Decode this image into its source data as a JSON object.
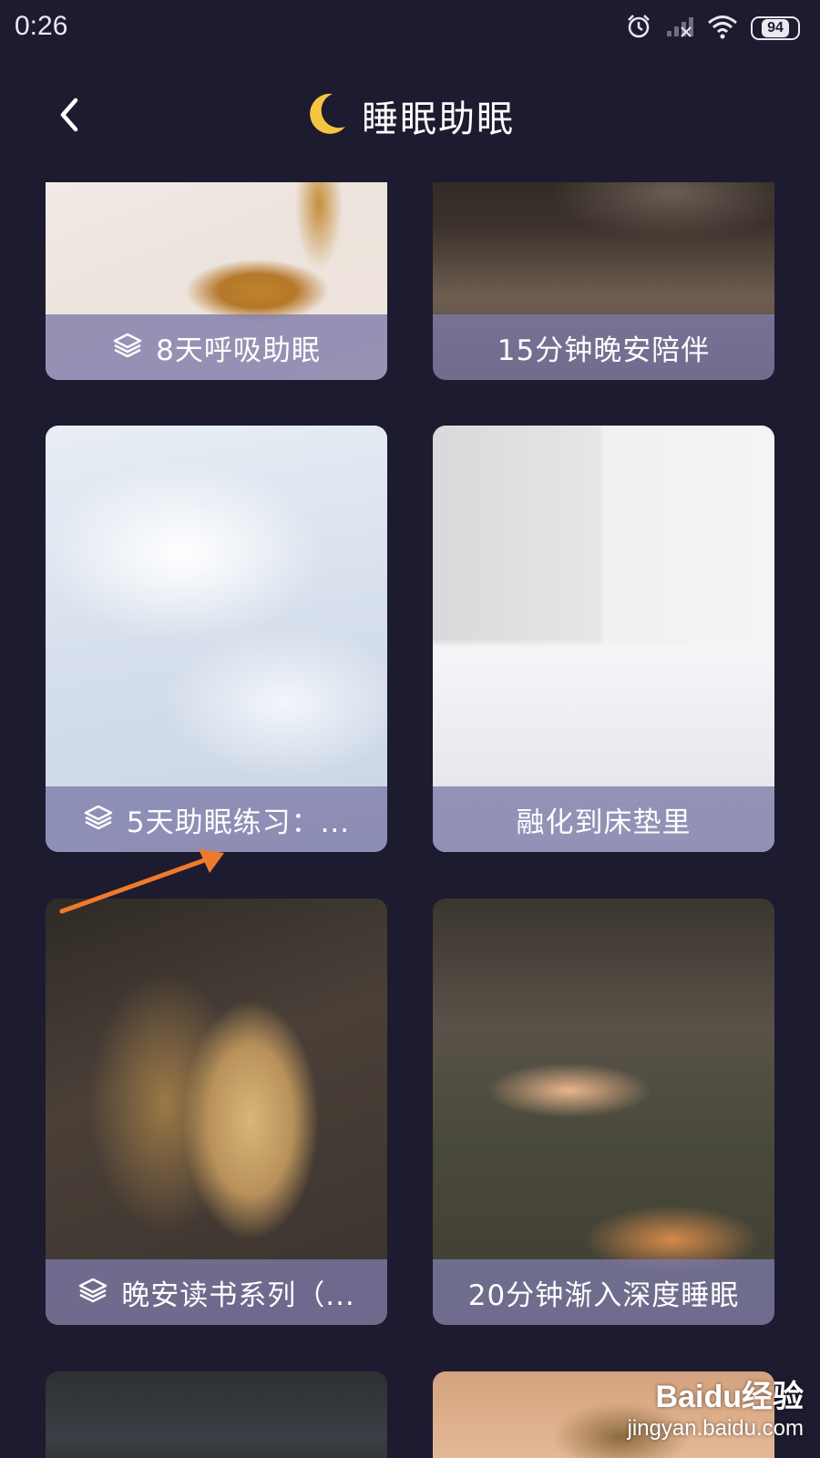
{
  "status_bar": {
    "time": "0:26",
    "battery": "94",
    "icons": [
      "alarm-icon",
      "signal-icon",
      "wifi-icon",
      "battery-icon"
    ]
  },
  "header": {
    "back_icon": "back-arrow-icon",
    "moon_icon": "moon-icon",
    "title": "睡眠助眠"
  },
  "cards": [
    {
      "label": "8天呼吸助眠",
      "series": true,
      "image": "golden sand swirl"
    },
    {
      "label": "15分钟晚安陪伴",
      "series": false,
      "image": "dark bedroom"
    },
    {
      "label": "5天助眠练习：...",
      "series": true,
      "image": "white feathers"
    },
    {
      "label": "融化到床垫里",
      "series": false,
      "image": "white bed"
    },
    {
      "label": "晚安读书系列（...",
      "series": true,
      "image": "open book"
    },
    {
      "label": "20分钟渐入深度睡眠",
      "series": false,
      "image": "sleeping cats"
    }
  ],
  "watermark": {
    "logo": "Baidu经验",
    "url": "jingyan.baidu.com"
  },
  "colors": {
    "background": "#1d1b2f",
    "label_overlay": "#7c7aa8",
    "moon": "#f5c542",
    "annotation": "#f07a2b"
  }
}
